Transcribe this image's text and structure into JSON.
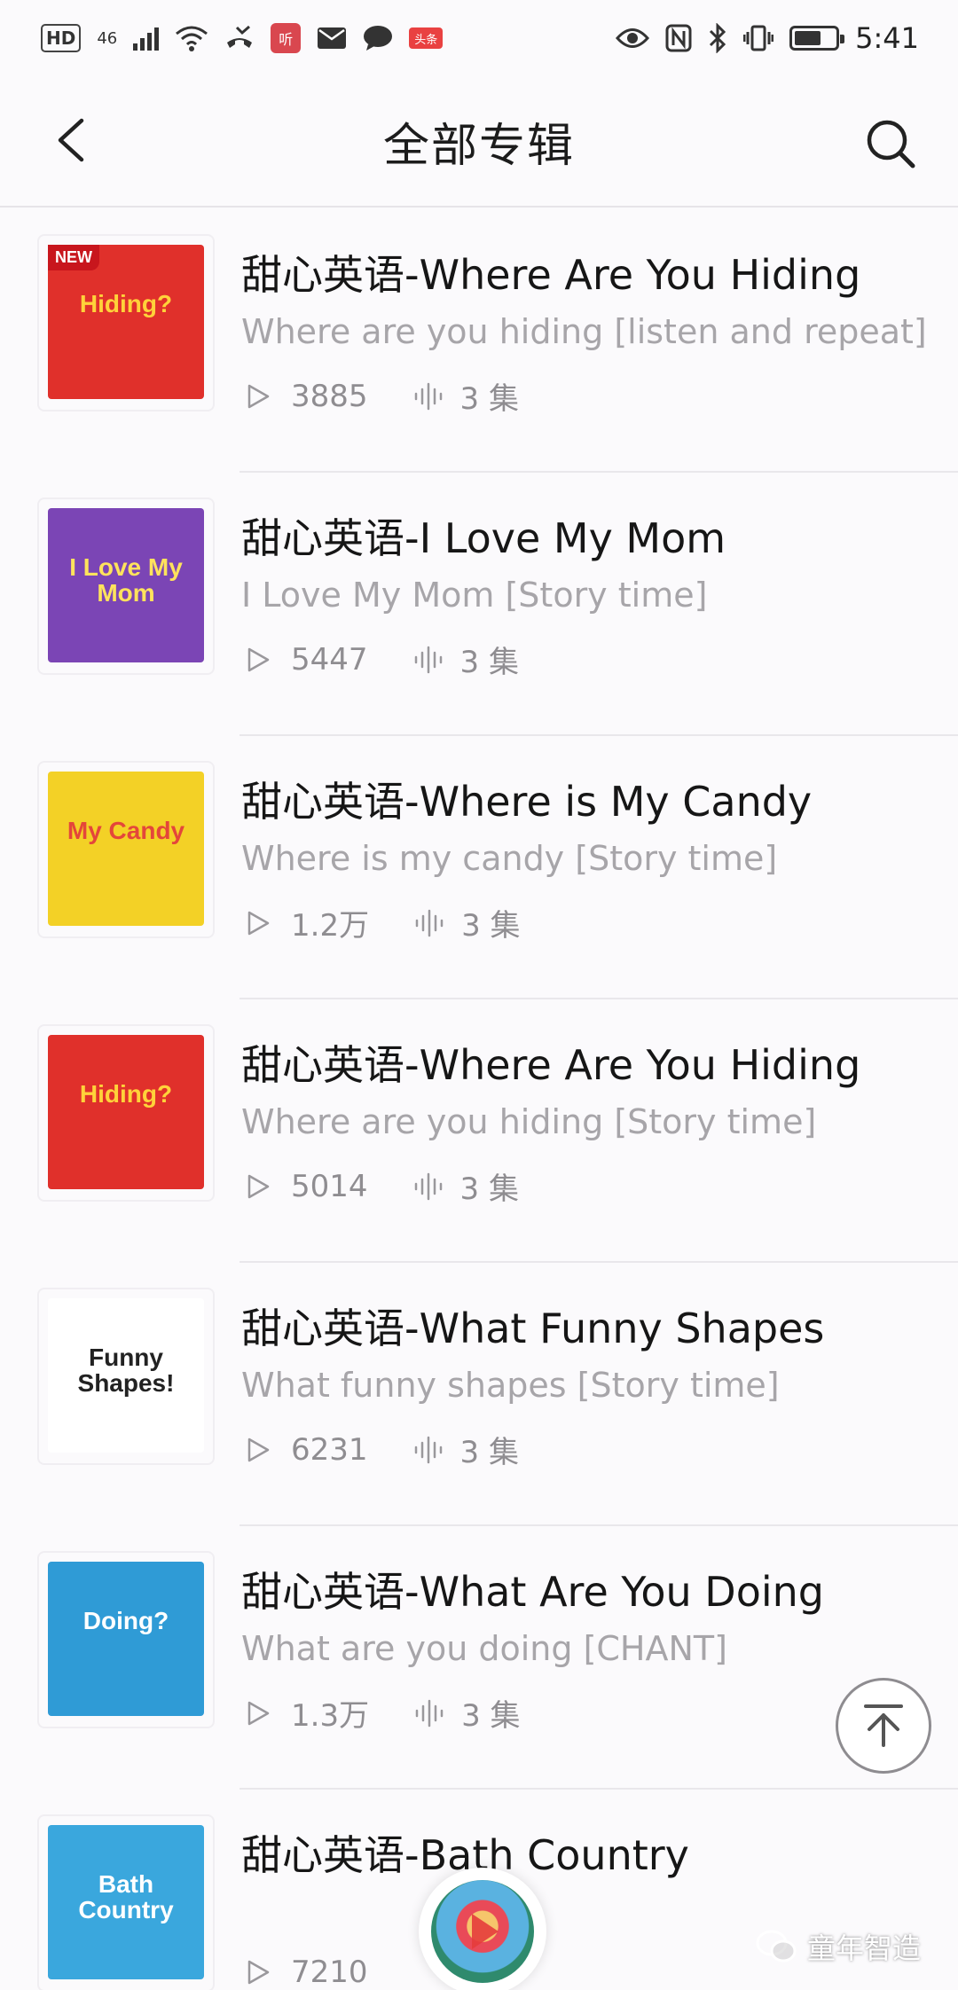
{
  "status_bar": {
    "hd": "HD",
    "network": "46",
    "app_badge_1": "听",
    "app_badge_2": "头条",
    "time": "5:41",
    "battery_level": 0.65
  },
  "header": {
    "title": "全部专辑"
  },
  "albums": [
    {
      "title": "甜心英语-Where Are You Hiding",
      "subtitle": "Where are you hiding [listen and repeat]",
      "plays": "3885",
      "episodes": "3 集",
      "cover_text": "Hiding?",
      "cover_color": "#e0302b",
      "cover_text_color": "#ffd23a",
      "badge": "NEW"
    },
    {
      "title": "甜心英语-I Love My Mom",
      "subtitle": "I Love My Mom [Story time]",
      "plays": "5447",
      "episodes": "3 集",
      "cover_text": "I Love My Mom",
      "cover_color": "#7b45b5",
      "cover_text_color": "#ffe35c",
      "badge": ""
    },
    {
      "title": "甜心英语-Where is My Candy",
      "subtitle": "Where is my candy [Story time]",
      "plays": "1.2万",
      "episodes": "3 集",
      "cover_text": "My Candy",
      "cover_color": "#f3d126",
      "cover_text_color": "#e4463a",
      "badge": ""
    },
    {
      "title": "甜心英语-Where Are You Hiding",
      "subtitle": "Where are you hiding [Story time]",
      "plays": "5014",
      "episodes": "3 集",
      "cover_text": "Hiding?",
      "cover_color": "#e0302b",
      "cover_text_color": "#ffd23a",
      "badge": ""
    },
    {
      "title": "甜心英语-What Funny Shapes",
      "subtitle": "What funny shapes [Story time]",
      "plays": "6231",
      "episodes": "3 集",
      "cover_text": "Funny Shapes!",
      "cover_color": "#ffffff",
      "cover_text_color": "#222222",
      "badge": ""
    },
    {
      "title": "甜心英语-What Are You Doing",
      "subtitle": "What are you doing [CHANT]",
      "plays": "1.3万",
      "episodes": "3 集",
      "cover_text": "Doing?",
      "cover_color": "#2f9bd6",
      "cover_text_color": "#ffffff",
      "badge": ""
    },
    {
      "title": "甜心英语-Bath Country",
      "subtitle": "",
      "plays": "7210",
      "episodes": "",
      "cover_text": "Bath Country",
      "cover_color": "#3aa7dd",
      "cover_text_color": "#ffffff",
      "badge": ""
    }
  ],
  "watermark": {
    "text": "童年智造",
    "icon": "wechat-icon"
  },
  "colors": {
    "background": "#fbfafc",
    "secondary_text": "#a7a5a9",
    "divider": "#e9e7eb"
  }
}
